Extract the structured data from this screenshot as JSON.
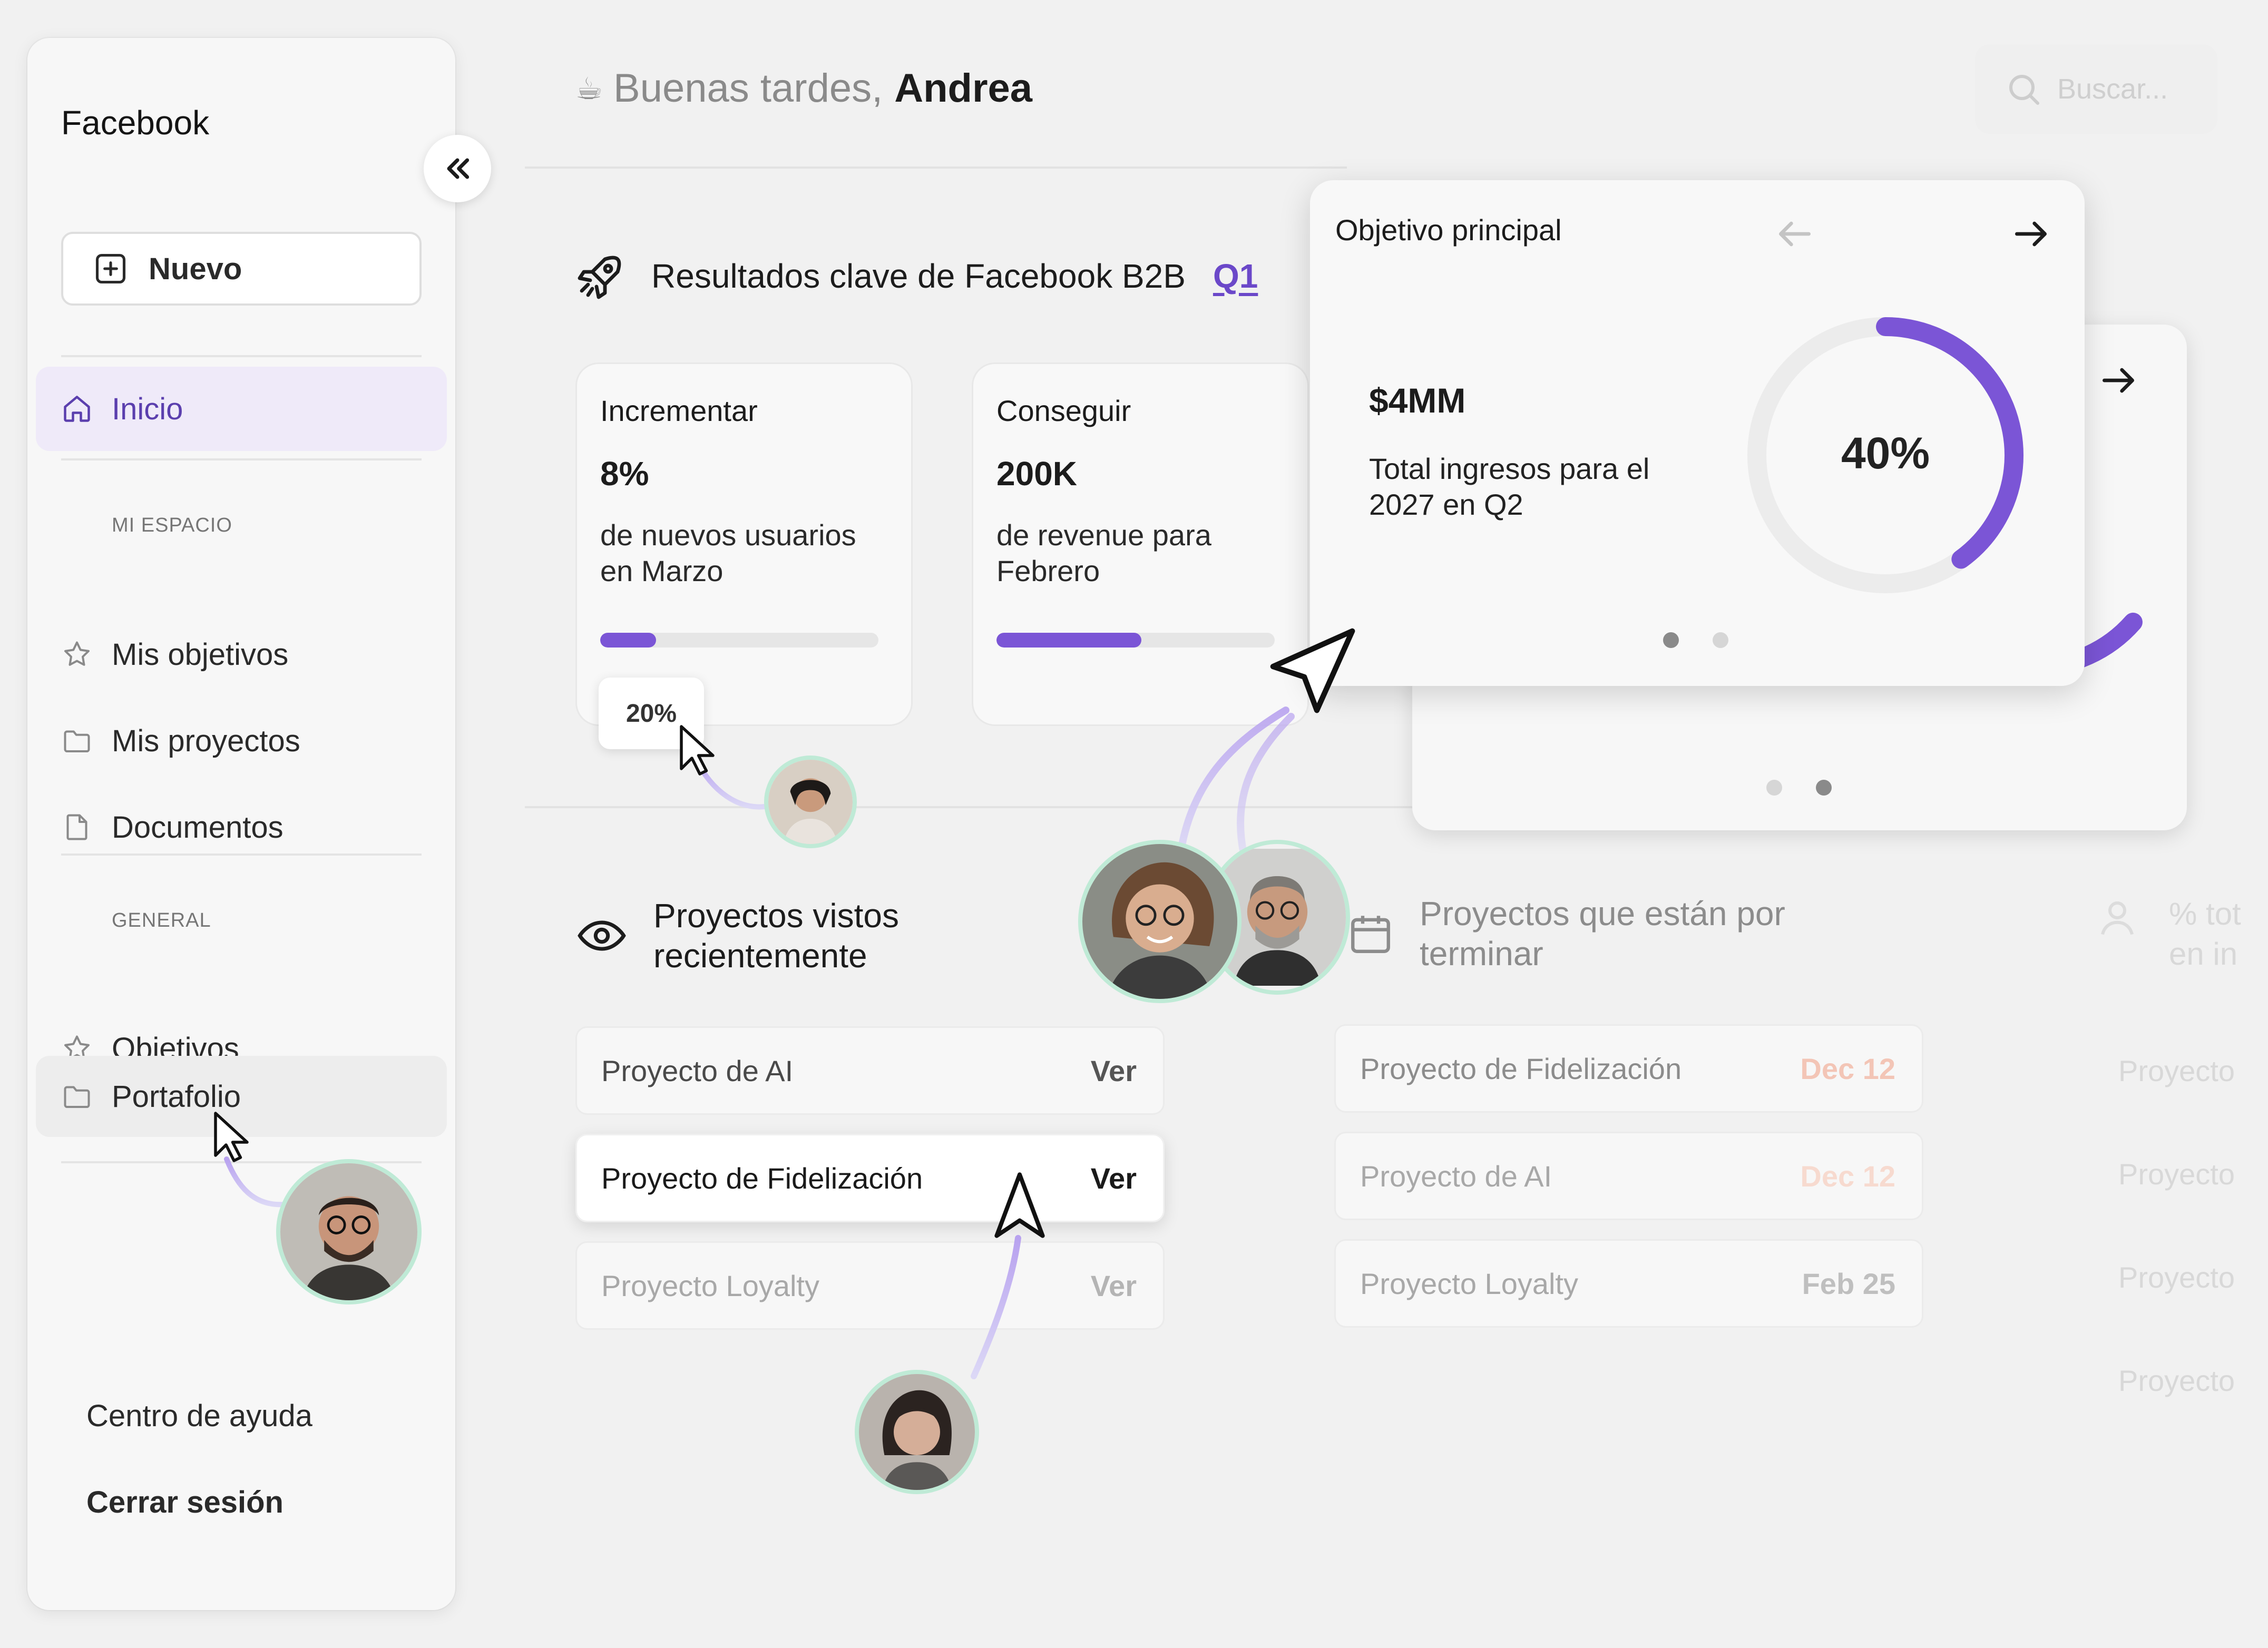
{
  "sidebar": {
    "brand": "Facebook",
    "new_button": "Nuevo",
    "items": [
      {
        "label": "Inicio",
        "icon": "home-icon"
      },
      {
        "label": "Mis objetivos",
        "icon": "star-icon"
      },
      {
        "label": "Mis proyectos",
        "icon": "folder-icon"
      },
      {
        "label": "Documentos",
        "icon": "file-icon"
      },
      {
        "label": "Objetivos",
        "icon": "star-icon"
      },
      {
        "label": "Portafolio",
        "icon": "folder-icon"
      }
    ],
    "section_my_space": "MI ESPACIO",
    "section_general": "GENERAL",
    "help": "Centro de ayuda",
    "logout": "Cerrar sesión"
  },
  "header": {
    "emoji": "☕",
    "greeting": "Buenas tardes,",
    "user_name": "Andrea",
    "search_placeholder": "Buscar..."
  },
  "key_results": {
    "title": "Resultados clave de Facebook B2B",
    "quarter": "Q1",
    "cards": [
      {
        "verb": "Incrementar",
        "value": "8%",
        "description": "de nuevos usuarios en Marzo",
        "progress": 0.2,
        "progress_label": "20%"
      },
      {
        "verb": "Conseguir",
        "value": "200K",
        "description": "de revenue para Febrero",
        "progress": 0.52
      }
    ]
  },
  "main_goal": {
    "title": "Objetivo principal",
    "value": "$4MM",
    "description": "Total ingresos para el 2027 en Q2",
    "percent": 0.4,
    "percent_label": "40%",
    "page": 1,
    "pages": 2
  },
  "recent_projects": {
    "title": "Proyectos vistos recientemente",
    "rows": [
      {
        "name": "Proyecto de AI",
        "action": "Ver"
      },
      {
        "name": "Proyecto de Fidelización",
        "action": "Ver"
      },
      {
        "name": "Proyecto Loyalty",
        "action": "Ver"
      }
    ]
  },
  "ending_projects": {
    "title": "Proyectos que están por terminar",
    "rows": [
      {
        "name": "Proyecto de Fidelización",
        "date": "Dec 12"
      },
      {
        "name": "Proyecto de AI",
        "date": "Dec 12"
      },
      {
        "name": "Proyecto Loyalty",
        "date": "Feb 25"
      }
    ]
  },
  "third_column": {
    "title_line1": "% tot",
    "title_line2": "en in",
    "rows": [
      "Proyecto",
      "Proyecto",
      "Proyecto",
      "Proyecto"
    ]
  },
  "colors": {
    "accent": "#7b55d6",
    "accent_text": "#6b48c9",
    "avatar_ring": "#bfead6",
    "date_highlight": "#f3c5b6"
  }
}
